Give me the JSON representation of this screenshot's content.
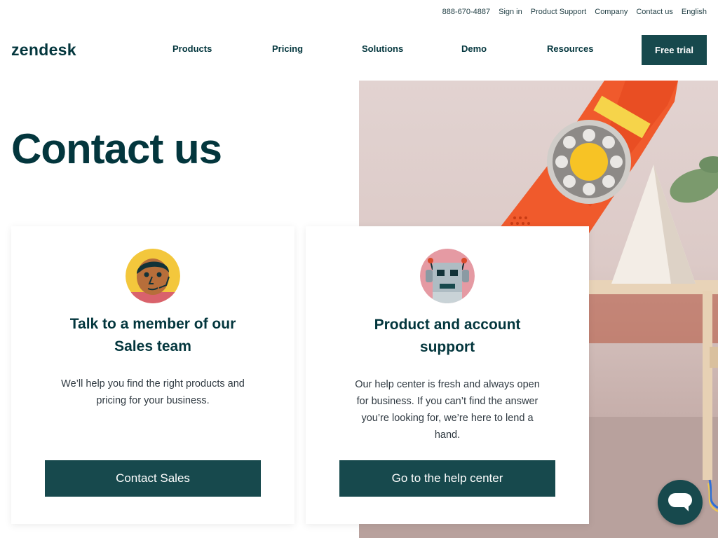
{
  "utility": {
    "phone": "888-670-4887",
    "sign_in": "Sign in",
    "product_support": "Product Support",
    "company": "Company",
    "contact_us": "Contact us",
    "language": "English"
  },
  "header": {
    "logo": "zendesk",
    "nav": [
      "Products",
      "Pricing",
      "Solutions",
      "Demo",
      "Resources"
    ],
    "cta": "Free trial"
  },
  "hero": {
    "title": "Contact us"
  },
  "cards": [
    {
      "heading_line1": "Talk to a member of our",
      "heading_line2": "Sales team",
      "description_lines": [
        "We’ll help you find the right products and",
        "pricing for your business."
      ],
      "button": "Contact Sales",
      "avatar_icon": "sales-person-icon"
    },
    {
      "heading_line1": "Product and account",
      "heading_line2": "support",
      "description_lines": [
        "Our help center is fresh and always open",
        "for business. If you can’t find the answer",
        "you’re looking for, we’re here to lend a",
        "hand."
      ],
      "button": "Go to the help center",
      "avatar_icon": "robot-icon"
    }
  ],
  "chat": {
    "icon": "chat-bubble-icon"
  },
  "colors": {
    "brand_dark": "#03363d",
    "button": "#17494d",
    "phone_orange": "#f05a2c",
    "dial_yellow": "#f7c325"
  }
}
